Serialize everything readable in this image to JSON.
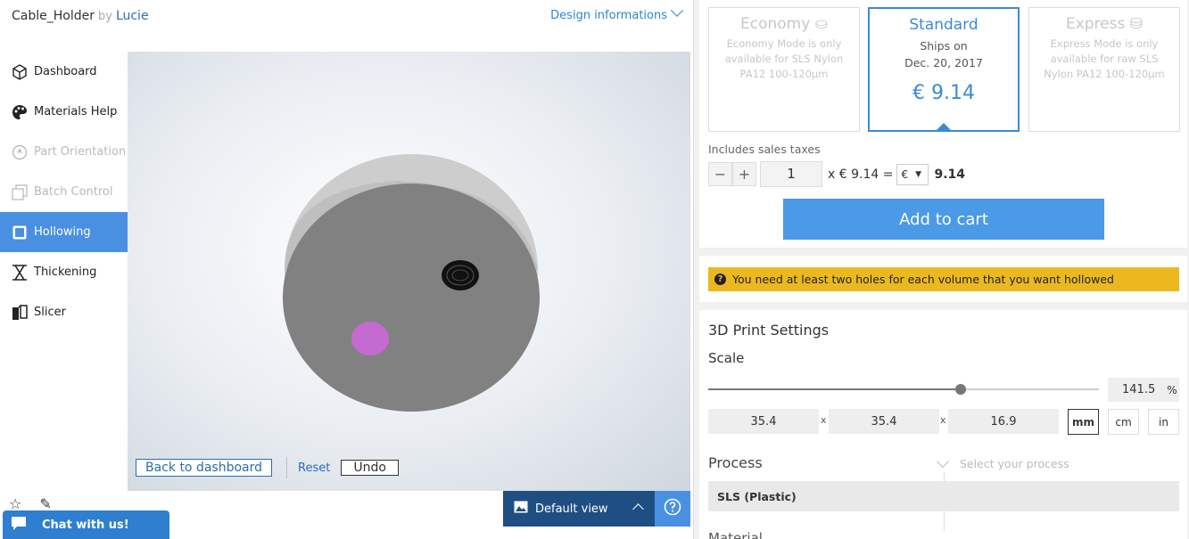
{
  "header": {
    "design_name": "Cable_Holder",
    "by": "by",
    "author": "Lucie",
    "design_info": "Design informations"
  },
  "sidebar": {
    "items": [
      {
        "label": "Dashboard",
        "icon": "cube-icon",
        "state": "normal"
      },
      {
        "label": "Materials Help",
        "icon": "palette-icon",
        "state": "normal"
      },
      {
        "label": "Part Orientation",
        "icon": "orientation-icon",
        "state": "disabled"
      },
      {
        "label": "Batch Control",
        "icon": "stack-icon",
        "state": "disabled"
      },
      {
        "label": "Hollowing",
        "icon": "hollow-square-icon",
        "state": "active"
      },
      {
        "label": "Thickening",
        "icon": "thicken-icon",
        "state": "normal"
      },
      {
        "label": "Slicer",
        "icon": "slicer-icon",
        "state": "normal"
      }
    ]
  },
  "viewer": {
    "back_label": "Back to dashboard",
    "reset_label": "Reset",
    "undo_label": "Undo",
    "default_view_label": "Default view",
    "help_icon": "question-icon",
    "model_color": "#808080",
    "hole_color": "#c66ad1"
  },
  "chat": {
    "label": "Chat with us!"
  },
  "shipping": {
    "economy": {
      "name": "Economy",
      "desc": "Economy Mode is only available for SLS Nylon PA12 100-120µm",
      "icon": "money-icon"
    },
    "standard": {
      "name": "Standard",
      "ships_on": "Ships on",
      "date": "Dec. 20, 2017",
      "price": "€ 9.14"
    },
    "express": {
      "name": "Express",
      "desc": "Express Mode is only available for raw SLS Nylon PA12 100-120µm",
      "icon": "fast-money-icon"
    }
  },
  "order": {
    "taxes_note": "Includes sales taxes",
    "minus": "−",
    "plus": "+",
    "quantity": "1",
    "unit_price_text": "x € 9.14 =",
    "currency": "€",
    "total": "9.14",
    "add_to_cart": "Add to cart"
  },
  "warning": {
    "text": "You need at least two holes for each volume that you want hollowed",
    "color": "#ebb91f"
  },
  "settings": {
    "title": "3D Print Settings",
    "scale_label": "Scale",
    "scale_value": "141.5",
    "scale_unit": "%",
    "scale_slider_fraction": 0.645,
    "dim_x": "35.4",
    "dim_y": "35.4",
    "dim_z": "16.9",
    "times": "x",
    "units": [
      "mm",
      "cm",
      "in"
    ],
    "selected_unit": "mm",
    "process_label": "Process",
    "process_placeholder": "Select your process",
    "process_option": "SLS (Plastic)",
    "material_label": "Material"
  },
  "colors": {
    "accent": "#4a90e2",
    "primary_button": "#4a9ae8",
    "dark_blue": "#1f4e82"
  }
}
